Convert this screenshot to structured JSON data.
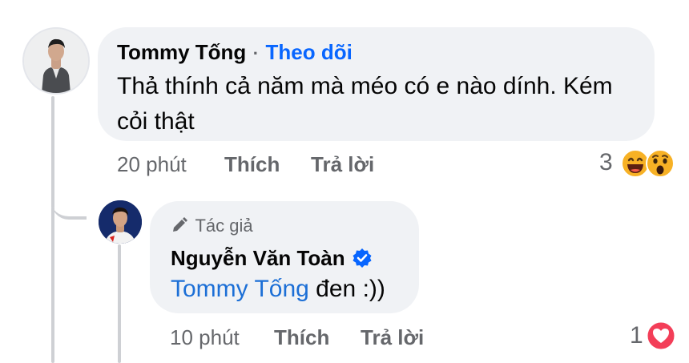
{
  "comment": {
    "author": "Tommy Tống",
    "separator": "·",
    "follow_label": "Theo dõi",
    "text_line1": "Thả thính cả năm mà méo có e nào dính. Kém",
    "text_line2": "cỏi thật",
    "time": "20 phút",
    "like_label": "Thích",
    "reply_label": "Trả lời",
    "reaction_count": "3",
    "reactions": [
      "laughing-emoji-icon",
      "wow-emoji-icon"
    ]
  },
  "reply": {
    "badge_label": "Tác giả",
    "author": "Nguyễn Văn Toàn",
    "mention": "Tommy Tống",
    "text": " đen :))",
    "time": "10 phút",
    "like_label": "Thích",
    "reply_label": "Trả lời",
    "reaction_count": "1",
    "reactions": [
      "heart-reaction-icon"
    ]
  },
  "colors": {
    "bubble": "#f0f2f5",
    "follow": "#0866ff",
    "verified": "#0866ff",
    "meta": "#65676b",
    "heart": "#f33e58",
    "emoji": "#f7b125"
  }
}
